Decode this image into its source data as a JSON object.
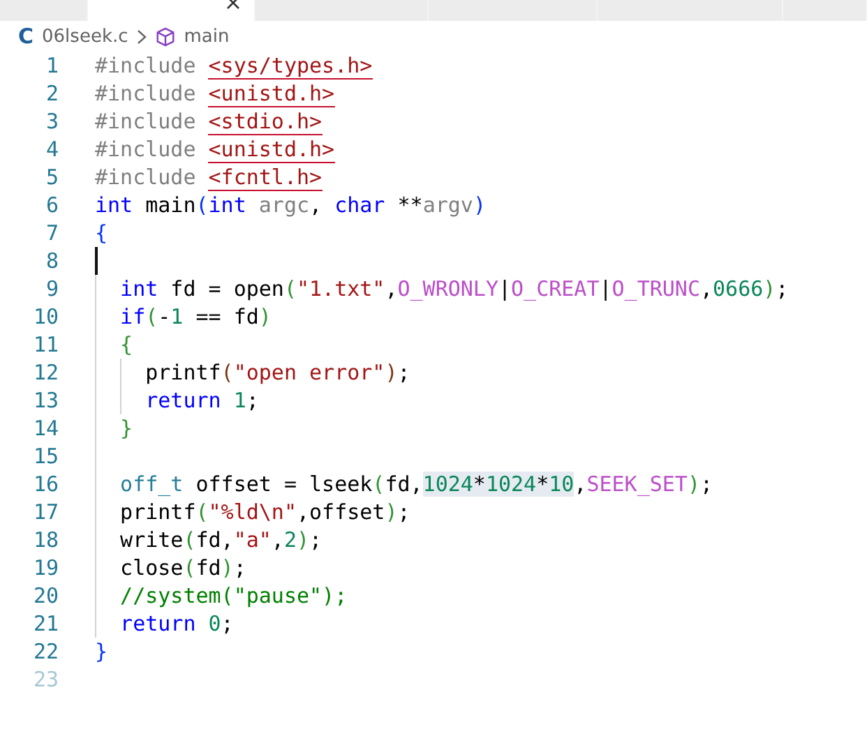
{
  "tabs": [
    {
      "selected": false
    },
    {
      "selected": true
    },
    {
      "selected": false
    },
    {
      "selected": false
    },
    {
      "selected": false
    },
    {
      "selected": false
    }
  ],
  "breadcrumb": {
    "file_icon": "C",
    "file": "06lseek.c",
    "symbol": "main"
  },
  "lines": [
    {
      "number": "1",
      "cursor": false,
      "dim": false,
      "tokens": [
        {
          "text": "#include ",
          "kind": "preproc"
        },
        {
          "text": "<sys/types.h>",
          "kind": "include"
        }
      ]
    },
    {
      "number": "2",
      "cursor": false,
      "dim": false,
      "tokens": [
        {
          "text": "#include ",
          "kind": "preproc"
        },
        {
          "text": "<unistd.h>",
          "kind": "include"
        }
      ]
    },
    {
      "number": "3",
      "cursor": false,
      "dim": false,
      "tokens": [
        {
          "text": "#include ",
          "kind": "preproc"
        },
        {
          "text": "<stdio.h>",
          "kind": "include"
        }
      ]
    },
    {
      "number": "4",
      "cursor": false,
      "dim": false,
      "tokens": [
        {
          "text": "#include ",
          "kind": "preproc"
        },
        {
          "text": "<unistd.h>",
          "kind": "include"
        }
      ]
    },
    {
      "number": "5",
      "cursor": false,
      "dim": false,
      "tokens": [
        {
          "text": "#include ",
          "kind": "preproc"
        },
        {
          "text": "<fcntl.h>",
          "kind": "include"
        }
      ]
    },
    {
      "number": "6",
      "cursor": false,
      "dim": false,
      "tokens": [
        {
          "text": "int",
          "kind": "keyword"
        },
        {
          "text": " main",
          "kind": "plain"
        },
        {
          "text": "(",
          "kind": "bracket1"
        },
        {
          "text": "int",
          "kind": "keyword"
        },
        {
          "text": " argc",
          "kind": "param"
        },
        {
          "text": ", ",
          "kind": "plain"
        },
        {
          "text": "char",
          "kind": "keyword"
        },
        {
          "text": " **",
          "kind": "plain"
        },
        {
          "text": "argv",
          "kind": "param"
        },
        {
          "text": ")",
          "kind": "bracket1"
        }
      ]
    },
    {
      "number": "7",
      "cursor": false,
      "dim": false,
      "tokens": [
        {
          "text": "{",
          "kind": "bracket1"
        }
      ]
    },
    {
      "number": "8",
      "cursor": true,
      "dim": false
    },
    {
      "number": "9",
      "cursor": false,
      "dim": false,
      "tokens": [
        {
          "text": "int",
          "kind": "keyword"
        },
        {
          "text": " fd = open",
          "kind": "plain"
        },
        {
          "text": "(",
          "kind": "bracket2"
        },
        {
          "text": "\"1.txt\"",
          "kind": "string"
        },
        {
          "text": ",",
          "kind": "plain"
        },
        {
          "text": "O_WRONLY",
          "kind": "macro"
        },
        {
          "text": "|",
          "kind": "plain"
        },
        {
          "text": "O_CREAT",
          "kind": "macro"
        },
        {
          "text": "|",
          "kind": "plain"
        },
        {
          "text": "O_TRUNC",
          "kind": "macro"
        },
        {
          "text": ",",
          "kind": "plain"
        },
        {
          "text": "0666",
          "kind": "number"
        },
        {
          "text": ")",
          "kind": "bracket2"
        },
        {
          "text": ";",
          "kind": "plain"
        }
      ]
    },
    {
      "number": "10",
      "cursor": false,
      "dim": false,
      "tokens": [
        {
          "text": "if",
          "kind": "keyword"
        },
        {
          "text": "(",
          "kind": "bracket2"
        },
        {
          "text": "-",
          "kind": "plain"
        },
        {
          "text": "1",
          "kind": "number"
        },
        {
          "text": " == fd",
          "kind": "plain"
        },
        {
          "text": ")",
          "kind": "bracket2"
        }
      ]
    },
    {
      "number": "11",
      "cursor": false,
      "dim": false,
      "tokens": [
        {
          "text": "{",
          "kind": "bracket2"
        }
      ]
    },
    {
      "number": "12",
      "cursor": false,
      "dim": false,
      "tokens": [
        {
          "text": "printf",
          "kind": "plain"
        },
        {
          "text": "(",
          "kind": "bracket3"
        },
        {
          "text": "\"open error\"",
          "kind": "string"
        },
        {
          "text": ")",
          "kind": "bracket3"
        },
        {
          "text": ";",
          "kind": "plain"
        }
      ]
    },
    {
      "number": "13",
      "cursor": false,
      "dim": false,
      "tokens": [
        {
          "text": "return ",
          "kind": "keyword"
        },
        {
          "text": "1",
          "kind": "number"
        },
        {
          "text": ";",
          "kind": "plain"
        }
      ]
    },
    {
      "number": "14",
      "cursor": false,
      "dim": false,
      "tokens": [
        {
          "text": "}",
          "kind": "bracket2"
        }
      ]
    },
    {
      "number": "15",
      "cursor": false,
      "dim": false
    },
    {
      "number": "16",
      "cursor": false,
      "dim": false,
      "tokens": [
        {
          "text": "off_t",
          "kind": "type"
        },
        {
          "text": " offset = lseek",
          "kind": "plain"
        },
        {
          "text": "(",
          "kind": "bracket2"
        },
        {
          "text": "fd,",
          "kind": "plain"
        },
        {
          "kind": "highlight",
          "parts": [
            {
              "text": "1024",
              "kind": "number"
            },
            {
              "text": "*",
              "kind": "plain"
            },
            {
              "text": "1024",
              "kind": "number"
            },
            {
              "text": "*",
              "kind": "plain"
            },
            {
              "text": "10",
              "kind": "number"
            }
          ]
        },
        {
          "text": ",",
          "kind": "plain"
        },
        {
          "text": "SEEK_SET",
          "kind": "macro"
        },
        {
          "text": ")",
          "kind": "bracket2"
        },
        {
          "text": ";",
          "kind": "plain"
        }
      ]
    },
    {
      "number": "17",
      "cursor": false,
      "dim": false,
      "tokens": [
        {
          "text": "printf",
          "kind": "plain"
        },
        {
          "text": "(",
          "kind": "bracket2"
        },
        {
          "text": "\"%ld\\n\"",
          "kind": "string"
        },
        {
          "text": ",offset",
          "kind": "plain"
        },
        {
          "text": ")",
          "kind": "bracket2"
        },
        {
          "text": ";",
          "kind": "plain"
        }
      ]
    },
    {
      "number": "18",
      "cursor": false,
      "dim": false,
      "tokens": [
        {
          "text": "write",
          "kind": "plain"
        },
        {
          "text": "(",
          "kind": "bracket2"
        },
        {
          "text": "fd,",
          "kind": "plain"
        },
        {
          "text": "\"a\"",
          "kind": "string"
        },
        {
          "text": ",",
          "kind": "plain"
        },
        {
          "text": "2",
          "kind": "number"
        },
        {
          "text": ")",
          "kind": "bracket2"
        },
        {
          "text": ";",
          "kind": "plain"
        }
      ]
    },
    {
      "number": "19",
      "cursor": false,
      "dim": false,
      "tokens": [
        {
          "text": "close",
          "kind": "plain"
        },
        {
          "text": "(",
          "kind": "bracket2"
        },
        {
          "text": "fd",
          "kind": "plain"
        },
        {
          "text": ")",
          "kind": "bracket2"
        },
        {
          "text": ";",
          "kind": "plain"
        }
      ]
    },
    {
      "number": "20",
      "cursor": false,
      "dim": false,
      "tokens": [
        {
          "text": "//system(\"pause\");",
          "kind": "comment"
        }
      ]
    },
    {
      "number": "21",
      "cursor": false,
      "dim": false,
      "tokens": [
        {
          "text": "return ",
          "kind": "keyword"
        },
        {
          "text": "0",
          "kind": "number"
        },
        {
          "text": ";",
          "kind": "plain"
        }
      ]
    },
    {
      "number": "22",
      "cursor": false,
      "dim": false,
      "tokens": [
        {
          "text": "}",
          "kind": "bracket1"
        }
      ]
    },
    {
      "number": "23",
      "cursor": false,
      "dim": true
    }
  ]
}
